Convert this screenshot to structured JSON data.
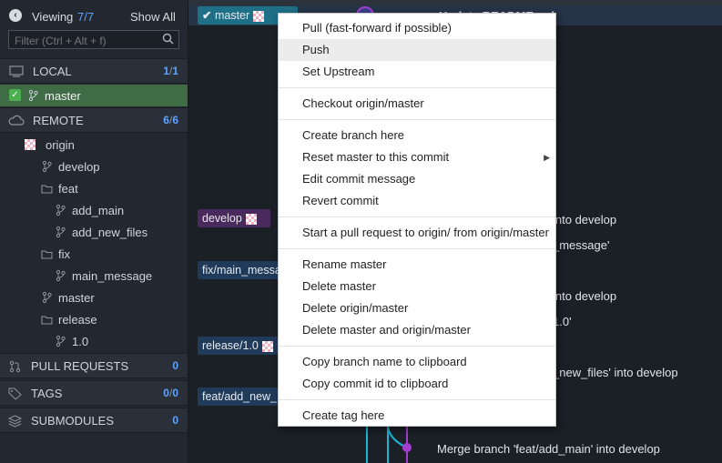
{
  "sidebar": {
    "viewing_label": "Viewing",
    "viewing_count": "7/7",
    "show_all": "Show All",
    "filter_placeholder": "Filter (Ctrl + Alt + f)",
    "local": {
      "label": "LOCAL",
      "count_a": "1",
      "count_b": "1"
    },
    "local_branch": "master",
    "remote": {
      "label": "REMOTE",
      "count_a": "6",
      "count_b": "6"
    },
    "remote_items": {
      "origin": "origin",
      "develop": "develop",
      "feat": "feat",
      "add_main": "add_main",
      "add_new_files": "add_new_files",
      "fix": "fix",
      "main_message": "main_message",
      "master": "master",
      "release": "release",
      "v1": "1.0"
    },
    "pull_requests": {
      "label": "PULL REQUESTS",
      "count": "0"
    },
    "tags": {
      "label": "TAGS",
      "count_a": "0",
      "count_b": "0"
    },
    "submodules": {
      "label": "SUBMODULES",
      "count": "0"
    }
  },
  "graph": {
    "branch_tags": {
      "master": "master",
      "develop": "develop",
      "fix": "fix/main_messa",
      "release": "release/1.0",
      "feat": "feat/add_new_"
    },
    "commits": {
      "c1": "Update README.md",
      "c2": "into develop",
      "c3": "_message'",
      "c4": "into develop",
      "c5": "1.0'",
      "c6": "_new_files' into develop",
      "c7": "Merge branch 'feat/add_main' into develop"
    }
  },
  "context_menu": {
    "pull": "Pull (fast-forward if possible)",
    "push": "Push",
    "set_upstream": "Set Upstream",
    "checkout": "Checkout origin/master",
    "create_branch": "Create branch here",
    "reset": "Reset master to this commit",
    "edit_message": "Edit commit message",
    "revert": "Revert commit",
    "start_pr": "Start a pull request to origin/ from origin/master",
    "rename": "Rename master",
    "delete": "Delete master",
    "delete_origin": "Delete origin/master",
    "delete_both": "Delete master and origin/master",
    "copy_branch": "Copy branch name to clipboard",
    "copy_commit": "Copy commit id to clipboard",
    "create_tag": "Create tag here"
  },
  "colors": {
    "accent_blue": "#5fa3ff",
    "local_highlight": "#3f6b45",
    "master_tag": "#1f6f86",
    "develop_tag": "#4a2a5c",
    "graph_purple": "#a23dd0",
    "graph_cyan": "#19b7d6"
  }
}
